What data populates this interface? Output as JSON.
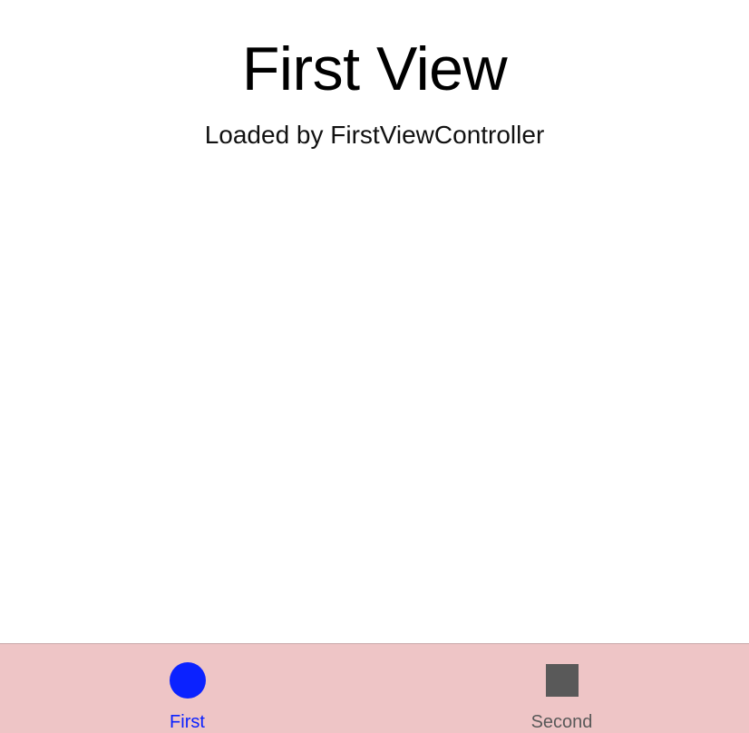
{
  "main": {
    "title": "First View",
    "subtitle": "Loaded by FirstViewController"
  },
  "tab_bar": {
    "background": "#eec5c6",
    "tabs": [
      {
        "label": "First",
        "icon": "circle-icon",
        "selected": true,
        "color": "#0b22ff"
      },
      {
        "label": "Second",
        "icon": "square-icon",
        "selected": false,
        "color": "#595959"
      }
    ]
  }
}
